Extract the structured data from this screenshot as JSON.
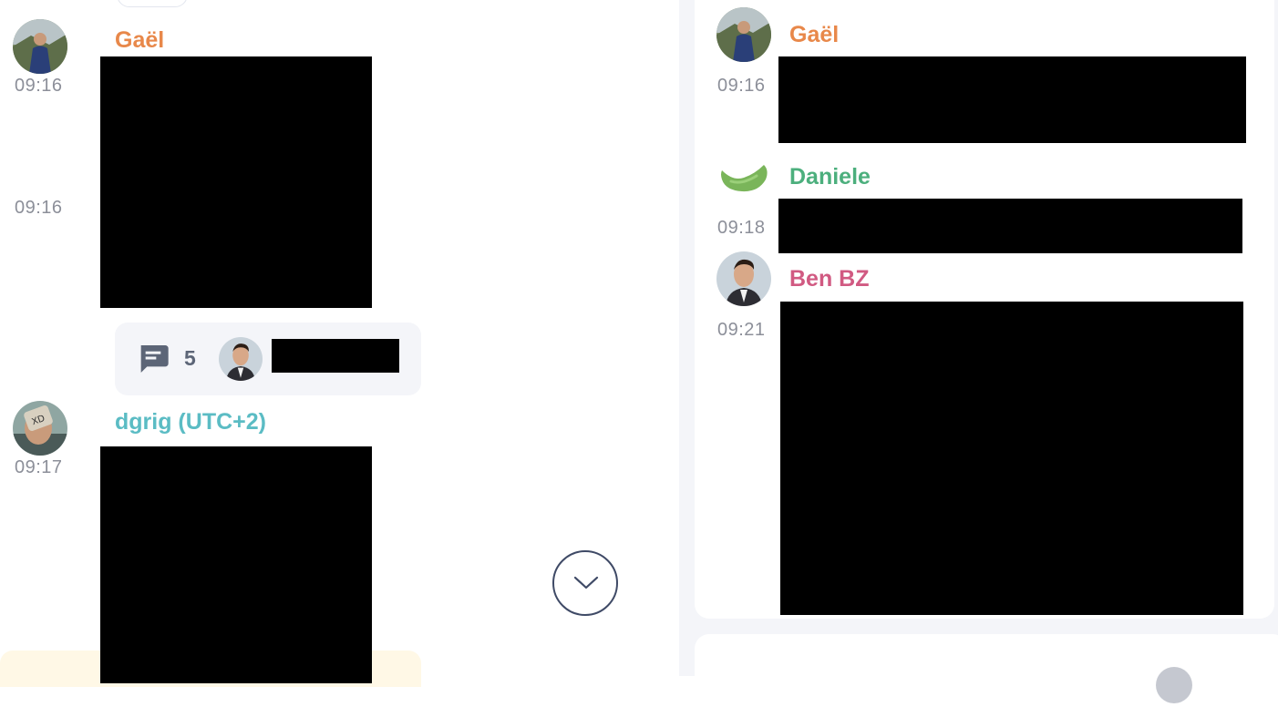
{
  "main_timeline": {
    "messages": [
      {
        "author": "Gaël",
        "time": "09:16",
        "author_color": "#e8884a"
      },
      {
        "time": "09:16"
      },
      {
        "author": "dgrig (UTC+2)",
        "time": "09:17",
        "author_color": "#5bbcc4"
      }
    ],
    "thread_summary": {
      "reply_count": "5",
      "icon": "chat-bubble-icon"
    },
    "scroll_button_icon": "chevron-down-icon"
  },
  "thread_panel": {
    "messages": [
      {
        "author": "Gaël",
        "time": "09:16",
        "author_color": "#e8884a"
      },
      {
        "author": "Daniele",
        "time": "09:18",
        "author_color": "#4caf7d"
      },
      {
        "author": "Ben BZ",
        "time": "09:21",
        "author_color": "#d15a82"
      }
    ]
  },
  "colors": {
    "panel_bg": "#f4f5f9",
    "timestamp": "#8c8f99",
    "icon": "#3f4a66"
  }
}
